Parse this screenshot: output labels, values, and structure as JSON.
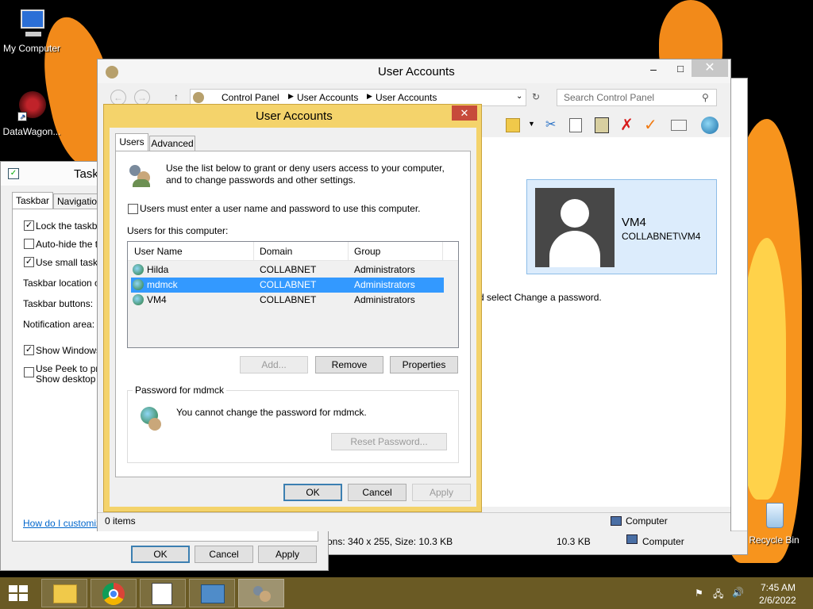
{
  "desktop": {
    "icons": [
      {
        "label": "My Computer"
      },
      {
        "label": "DataWagon..."
      },
      {
        "label": "Recycle Bin"
      }
    ]
  },
  "taskbar_props": {
    "title": "Task",
    "tabs": [
      "Taskbar",
      "Navigation"
    ],
    "options": {
      "lock": "Lock the taskbar",
      "autohide": "Auto-hide the ta",
      "small": "Use small taskba",
      "location": "Taskbar location on",
      "buttons": "Taskbar buttons:",
      "notification": "Notification area:",
      "show_windows": "Show Windows S",
      "peek1": "Use Peek to prev",
      "peek2": "Show desktop bu"
    },
    "help_link": "How do I customize",
    "ok": "OK",
    "cancel": "Cancel",
    "apply": "Apply"
  },
  "explorer_back": {
    "status_text": "ons: 340 x 255, Size: 10.3 KB",
    "size": "10.3 KB",
    "location": "Computer"
  },
  "control_panel": {
    "title": "User Accounts",
    "breadcrumb": [
      "Control Panel",
      "User Accounts",
      "User Accounts"
    ],
    "search_placeholder": "Search Control Panel",
    "user_card": {
      "name": "VM4",
      "domain": "COLLABNET\\VM4"
    },
    "partial_text": "d select Change a password.",
    "status_items": "0 items",
    "status_location": "Computer"
  },
  "dialog": {
    "title": "User Accounts",
    "tabs": [
      "Users",
      "Advanced"
    ],
    "intro_line1": "Use the list below to grant or deny users access to your computer,",
    "intro_line2": "and to change passwords and other settings.",
    "must_login": "Users must enter a user name and password to use this computer.",
    "users_label": "Users for this computer:",
    "columns": [
      "User Name",
      "Domain",
      "Group"
    ],
    "users": [
      {
        "name": "Hilda",
        "domain": "COLLABNET",
        "group": "Administrators"
      },
      {
        "name": "mdmck",
        "domain": "COLLABNET",
        "group": "Administrators"
      },
      {
        "name": "VM4",
        "domain": "COLLABNET",
        "group": "Administrators"
      }
    ],
    "add": "Add...",
    "remove": "Remove",
    "properties": "Properties",
    "password_group": "Password for mdmck",
    "password_msg": "You cannot change the password for mdmck.",
    "reset": "Reset Password...",
    "ok": "OK",
    "cancel": "Cancel",
    "apply": "Apply"
  },
  "clock": {
    "time": "7:45 AM",
    "date": "2/6/2022"
  },
  "colors": {
    "dialog_frame": "#f4d36b",
    "selection": "#3399ff",
    "taskbar": "#6a5a24"
  }
}
